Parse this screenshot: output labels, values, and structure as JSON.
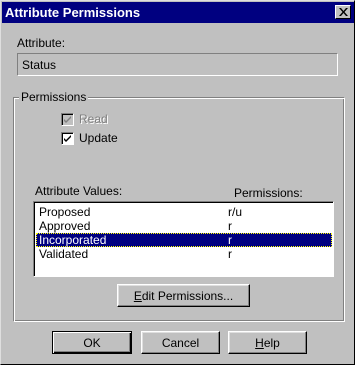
{
  "window": {
    "title": "Attribute Permissions",
    "close_glyph": "✕"
  },
  "attribute": {
    "label": "Attribute:",
    "value": "Status"
  },
  "permissions_group": {
    "legend": "Permissions",
    "checkboxes": [
      {
        "label": "Read",
        "checked": true,
        "enabled": false
      },
      {
        "label": "Update",
        "checked": true,
        "enabled": true
      }
    ]
  },
  "values_list": {
    "header_values": "Attribute Values:",
    "header_permissions": "Permissions:",
    "rows": [
      {
        "value": "Proposed",
        "permission": "r/u",
        "selected": false
      },
      {
        "value": "Approved",
        "permission": "r",
        "selected": false
      },
      {
        "value": "Incorporated",
        "permission": "r",
        "selected": true
      },
      {
        "value": "Validated",
        "permission": "r",
        "selected": false
      }
    ]
  },
  "buttons": {
    "edit_permissions": {
      "mnemonic": "E",
      "rest": "dit Permissions..."
    },
    "ok": "OK",
    "cancel": "Cancel",
    "help": {
      "mnemonic": "H",
      "rest": "elp"
    }
  },
  "colors": {
    "titlebar": "#000080",
    "face": "#c0c0c0",
    "selection": "#000080"
  }
}
